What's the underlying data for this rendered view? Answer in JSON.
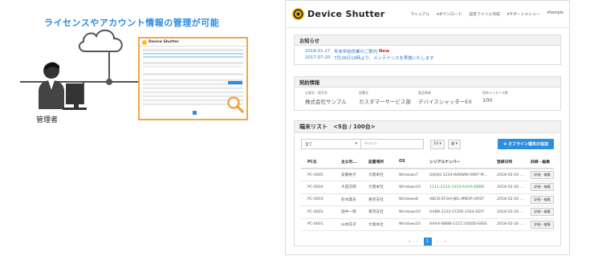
{
  "left": {
    "headline": "ライセンスやアカウント情報の管理が可能",
    "admin_label": "管理者",
    "mini": {
      "title": "Device Shutter"
    }
  },
  "app": {
    "brand": "Device Shutter",
    "nav": [
      "マニュアル",
      "▾ダウンロード",
      "設定ファイル作成",
      "▾サポートメニュー",
      "▾Sample"
    ],
    "news": {
      "title": "お知らせ",
      "items": [
        {
          "date": "2018-01-27",
          "text": "年末年始休業のご案内",
          "badge": "New"
        },
        {
          "date": "2017-07-20",
          "text": "7月26日19時より、メンテナンスを実施いたします",
          "badge": ""
        }
      ]
    },
    "contract": {
      "title": "契約情報",
      "fields": [
        {
          "label": "企業名・屋号名",
          "value": "株式会社サンプル"
        },
        {
          "label": "部署名",
          "value": "カスタマーサービス部"
        },
        {
          "label": "製品情報",
          "value": "デバイスシャッターEX"
        },
        {
          "label": "保有ライセンス数",
          "value": "100"
        }
      ]
    },
    "terminals": {
      "title": "端末リスト　<5台 / 100台>",
      "filter_value": "全て",
      "search_placeholder": "Search",
      "page_size": "10 ▾",
      "columns_btn": "▥ ▾",
      "add_button": "✚ オフライン端末の追加",
      "headers": [
        "PC名",
        "主な利...",
        "設置場所",
        "OS",
        "シリアルナンバー",
        "登録日時",
        "詳細・編集"
      ],
      "rows": [
        {
          "pc": "PC-0005",
          "user": "安藤裕子",
          "place": "大阪本社",
          "os": "Windows7",
          "serial": "QQQQ-1234-WWWW-0987-M...",
          "date": "2018-02-20 ...",
          "edit": "詳細・編集",
          "green": false
        },
        {
          "pc": "PC-0004",
          "user": "大田次郎",
          "place": "大阪本社",
          "os": "Windows10",
          "serial": "1111-2222-3333-AAAA-BBBB",
          "date": "2018-02-20 ...",
          "edit": "詳細・編集",
          "green": true
        },
        {
          "pc": "PC-0003",
          "user": "鈴木貫夫",
          "place": "東京支社",
          "os": "Windows8",
          "serial": "ABCD-EFGH-IJKL-MNOP-QRST",
          "date": "2018-02-20 ...",
          "edit": "詳細・編集",
          "green": false
        },
        {
          "pc": "PC-0002",
          "user": "田中一郎",
          "place": "東京支社",
          "os": "Windows10",
          "serial": "AABB-1122-CCDD-3344-EEFF",
          "date": "2018-02-20 ...",
          "edit": "詳細・編集",
          "green": false
        },
        {
          "pc": "PC-0001",
          "user": "山本花子",
          "place": "大阪本社",
          "os": "Windows10",
          "serial": "AAAA-BBBB-CCCC-DDDD-EEEE",
          "date": "2018-02-20 ...",
          "edit": "詳細・編集",
          "green": false
        }
      ],
      "pager": {
        "prev2": "«",
        "prev": "‹",
        "current": "1",
        "next": "›",
        "next2": "»"
      }
    }
  },
  "colors": {
    "accent": "#2b8fe0",
    "new_badge": "#e02020",
    "highlight_frame": "#f0a64a"
  },
  "icons": [
    "cloud-icon",
    "server-icon",
    "admin-person-icon",
    "magnifier-icon",
    "brand-logo-icon"
  ]
}
